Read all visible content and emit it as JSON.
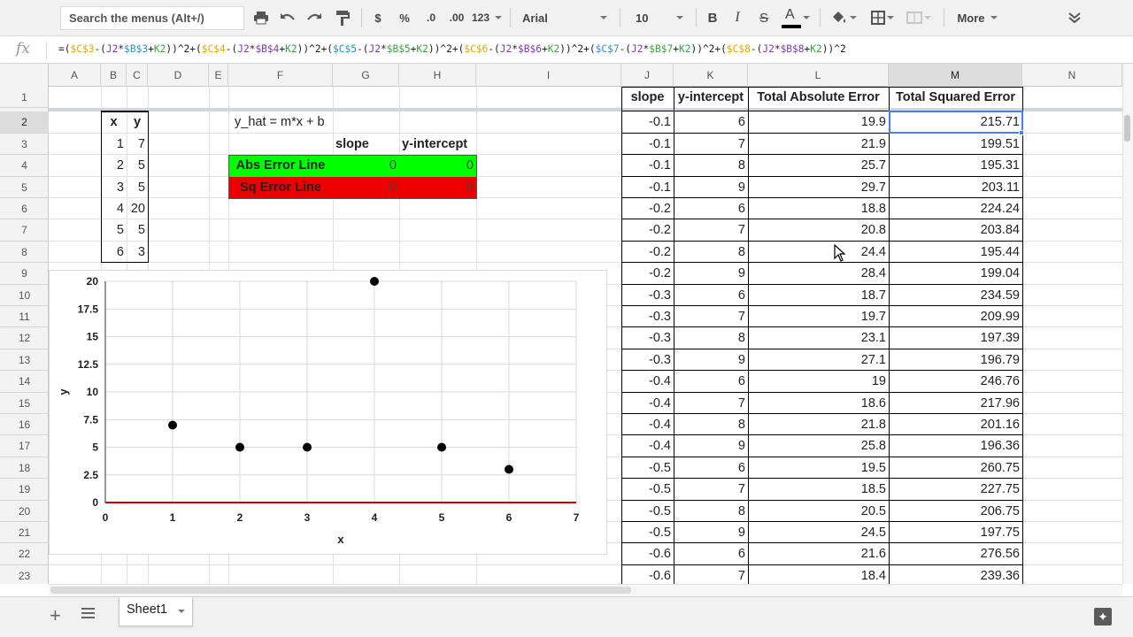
{
  "toolbar": {
    "search_placeholder": "Search the menus (Alt+/)",
    "currency_label": "$",
    "percent_label": "%",
    "decimal_decrease_label": ".0",
    "decimal_increase_label": ".00",
    "number_format_label": "123",
    "font_name": "Arial",
    "font_size": "10",
    "bold_label": "B",
    "italic_label": "I",
    "strike_label": "S",
    "text_color_label": "A",
    "more_label": "More"
  },
  "formula_bar": {
    "fx_label": "fx",
    "formula": "=($C$3-(J2*$B$3+K2))^2+($C$4-(J2*$B$4+K2))^2+($C$5-(J2*$B$5+K2))^2+($C$6-(J2*$B$6+K2))^2+($C$7-(J2*$B$7+K2))^2+($C$8-(J2*$B$8+K2))^2"
  },
  "column_headers": [
    "A",
    "B",
    "C",
    "D",
    "E",
    "F",
    "G",
    "H",
    "I",
    "J",
    "K",
    "L",
    "M",
    "N"
  ],
  "row_numbers": [
    "1",
    "2",
    "3",
    "4",
    "5",
    "6",
    "7",
    "8",
    "9",
    "10",
    "11",
    "12",
    "13",
    "14",
    "15",
    "16",
    "17",
    "18",
    "19",
    "20",
    "21",
    "22",
    "23"
  ],
  "selected": {
    "column": "M",
    "row": "2"
  },
  "xy_table": {
    "x_header": "x",
    "y_header": "y",
    "rows": [
      [
        "1",
        "7"
      ],
      [
        "2",
        "5"
      ],
      [
        "3",
        "5"
      ],
      [
        "4",
        "20"
      ],
      [
        "5",
        "5"
      ],
      [
        "6",
        "3"
      ]
    ]
  },
  "model": {
    "equation": "y_hat = m*x + b",
    "slope_header": "slope",
    "intercept_header": "y-intercept",
    "abs_label": "Abs Error Line",
    "abs_slope": "0",
    "abs_intercept": "0",
    "sq_label": "Sq Error Line",
    "sq_slope": "0",
    "sq_intercept": "0"
  },
  "colors": {
    "abs_row_bg": "#00ff00",
    "sq_row_bg": "#ee0000",
    "selection": "#4a7ee8",
    "fit_line": "#cc0000",
    "points": "#000000"
  },
  "results": {
    "headers": [
      "slope",
      "y-intercept",
      "Total Absolute Error",
      "Total Squared Error"
    ],
    "rows": [
      [
        "-0.1",
        "6",
        "19.9",
        "215.71"
      ],
      [
        "-0.1",
        "7",
        "21.9",
        "199.51"
      ],
      [
        "-0.1",
        "8",
        "25.7",
        "195.31"
      ],
      [
        "-0.1",
        "9",
        "29.7",
        "203.11"
      ],
      [
        "-0.2",
        "6",
        "18.8",
        "224.24"
      ],
      [
        "-0.2",
        "7",
        "20.8",
        "203.84"
      ],
      [
        "-0.2",
        "8",
        "24.4",
        "195.44"
      ],
      [
        "-0.2",
        "9",
        "28.4",
        "199.04"
      ],
      [
        "-0.3",
        "6",
        "18.7",
        "234.59"
      ],
      [
        "-0.3",
        "7",
        "19.7",
        "209.99"
      ],
      [
        "-0.3",
        "8",
        "23.1",
        "197.39"
      ],
      [
        "-0.3",
        "9",
        "27.1",
        "196.79"
      ],
      [
        "-0.4",
        "6",
        "19",
        "246.76"
      ],
      [
        "-0.4",
        "7",
        "18.6",
        "217.96"
      ],
      [
        "-0.4",
        "8",
        "21.8",
        "201.16"
      ],
      [
        "-0.4",
        "9",
        "25.8",
        "196.36"
      ],
      [
        "-0.5",
        "6",
        "19.5",
        "260.75"
      ],
      [
        "-0.5",
        "7",
        "18.5",
        "227.75"
      ],
      [
        "-0.5",
        "8",
        "20.5",
        "206.75"
      ],
      [
        "-0.5",
        "9",
        "24.5",
        "197.75"
      ],
      [
        "-0.6",
        "6",
        "21.6",
        "276.56"
      ],
      [
        "-0.6",
        "7",
        "18.4",
        "239.36"
      ]
    ]
  },
  "chart_data": {
    "type": "scatter",
    "title": "",
    "xlabel": "x",
    "ylabel": "y",
    "xlim": [
      0,
      7
    ],
    "ylim": [
      0,
      20
    ],
    "xticks": [
      "0",
      "1",
      "2",
      "3",
      "4",
      "5",
      "6",
      "7"
    ],
    "yticks": [
      "0",
      "2.5",
      "5",
      "7.5",
      "10",
      "12.5",
      "15",
      "17.5",
      "20"
    ],
    "grid": true,
    "series": [
      {
        "type": "scatter",
        "x": [
          1,
          2,
          3,
          4,
          5,
          6
        ],
        "y": [
          7,
          5,
          5,
          20,
          5,
          3
        ]
      },
      {
        "type": "line",
        "x": [
          0,
          7
        ],
        "y": [
          0,
          0
        ]
      }
    ]
  },
  "sheet_tabs": [
    "Sheet1"
  ]
}
